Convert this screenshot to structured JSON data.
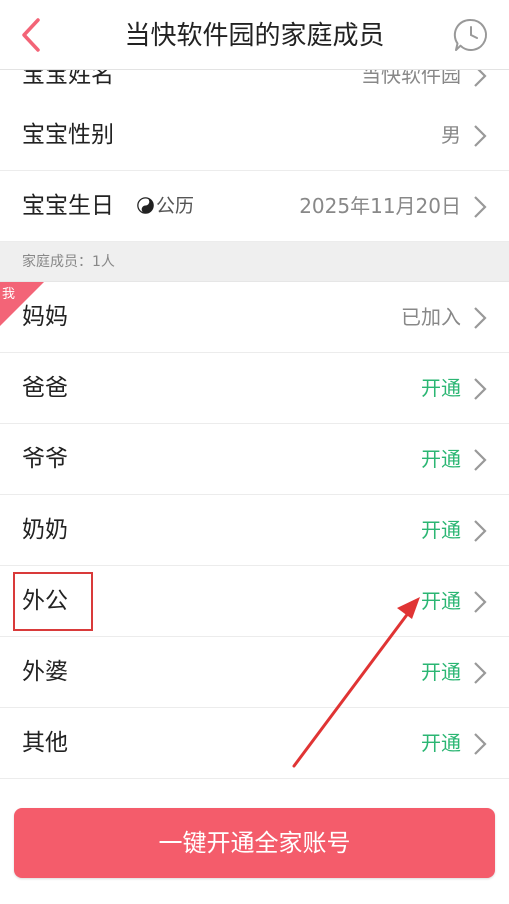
{
  "header": {
    "title": "当快软件园的家庭成员"
  },
  "profile_rows": [
    {
      "label": "宝宝姓名",
      "value": "当快软件园"
    },
    {
      "label": "宝宝性别",
      "value": "男"
    },
    {
      "label": "宝宝生日",
      "calendar_type": "公历",
      "value": "2025年11月20日"
    }
  ],
  "family_section": {
    "title": "家庭成员：1人"
  },
  "me_badge": "我",
  "members": [
    {
      "label": "妈妈",
      "status": "已加入"
    },
    {
      "label": "爸爸",
      "status": "开通"
    },
    {
      "label": "爷爷",
      "status": "开通"
    },
    {
      "label": "奶奶",
      "status": "开通"
    },
    {
      "label": "外公",
      "status": "开通"
    },
    {
      "label": "外婆",
      "status": "开通"
    },
    {
      "label": "其他",
      "status": "开通"
    }
  ],
  "bottom_button": "一键开通全家账号",
  "colors": {
    "accent_pink": "#f45c6b",
    "status_green": "#2bb673",
    "annotation_red": "#d93a3a"
  }
}
